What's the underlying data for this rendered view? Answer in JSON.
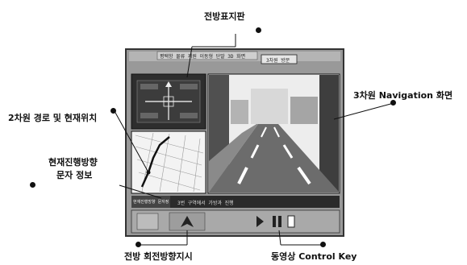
{
  "callouts": {
    "top": "전방표지판",
    "right": "3차원 Navigation 화면",
    "left_upper": "2차원 경로 및 현재위치",
    "left_lower_line1": "현재진행방향",
    "left_lower_line2": "문자 정보",
    "bottom_left": "전방 회전방향지시",
    "bottom_right": "동영상 Control Key"
  },
  "window": {
    "title": "평택항 물류 지원 이동형 단말 3D 화면",
    "mode_button": "3차원 방문"
  },
  "status_bar": {
    "label": "현재진행방향 문자정보",
    "text": "3번 구역에서 가방과 진행"
  },
  "colors": {
    "screen_bg": "#8f8f8f",
    "screen_border": "#3a3a3a",
    "sky": "#ececec",
    "road": "#6a6a6a",
    "map_bg": "#f2f2f2",
    "panel_dark": "#2d2d2d"
  }
}
